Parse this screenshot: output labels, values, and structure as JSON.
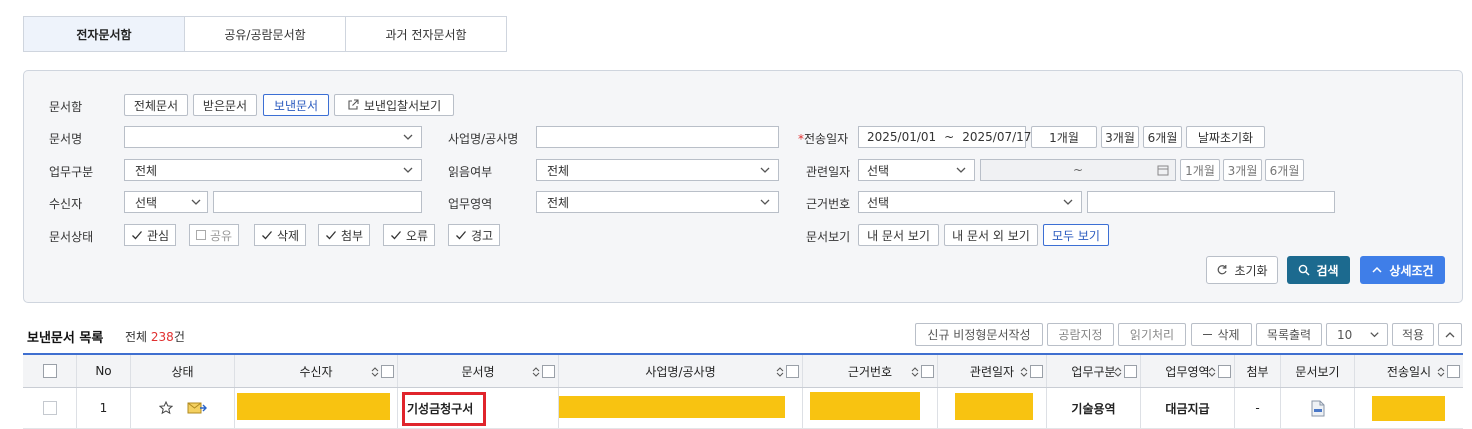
{
  "tabs": [
    "전자문서함",
    "공유/공람문서함",
    "과거 전자문서함"
  ],
  "labels": {
    "doc_box": "문서함",
    "doc_name": "문서명",
    "biz_name": "사업명/공사명",
    "send_date": "전송일자",
    "work_type": "업무구분",
    "read_status": "읽음여부",
    "related_date": "관련일자",
    "receiver": "수신자",
    "work_area": "업무영역",
    "basis_no": "근거번호",
    "doc_status": "문서상태",
    "doc_view": "문서보기"
  },
  "doc_box_buttons": [
    "전체문서",
    "받은문서",
    "보낸문서",
    "보낸입찰서보기"
  ],
  "doc_box_active": "보낸문서",
  "send_date": {
    "from": "2025/01/01",
    "sep": "~",
    "to": "2025/07/17"
  },
  "period_buttons": [
    "1개월",
    "3개월",
    "6개월"
  ],
  "date_reset": "날짜초기화",
  "selects": {
    "work_type": "전체",
    "read_status": "전체",
    "related_date": "선택",
    "receiver": "선택",
    "work_area": "전체",
    "basis_no": "선택"
  },
  "related_sep": "~",
  "status_checks": [
    {
      "label": "관심",
      "checked": true
    },
    {
      "label": "공유",
      "checked": false
    },
    {
      "label": "삭제",
      "checked": true
    },
    {
      "label": "첨부",
      "checked": true
    },
    {
      "label": "오류",
      "checked": true
    },
    {
      "label": "경고",
      "checked": true
    }
  ],
  "view_buttons": [
    "내 문서 보기",
    "내 문서 외 보기",
    "모두 보기"
  ],
  "view_active": "모두 보기",
  "actions": {
    "reset": "초기화",
    "search": "검색",
    "detail": "상세조건"
  },
  "list": {
    "title": "보낸문서 목록",
    "total_prefix": "전체 ",
    "total_count": "238",
    "total_suffix": "건"
  },
  "toolbar": [
    "신규 비정형문서작성",
    "공람지정",
    "읽기처리",
    "삭제",
    "목록출력"
  ],
  "page_size": "10",
  "apply": "적용",
  "columns": [
    "No",
    "상태",
    "수신자",
    "문서명",
    "사업명/공사명",
    "근거번호",
    "관련일자",
    "업무구분",
    "업무영역",
    "첨부",
    "문서보기",
    "전송일시"
  ],
  "rows": [
    {
      "no": "1",
      "doc_name": "기성금청구서",
      "work_type": "기술용역",
      "work_area": "대금지급",
      "attach": "-"
    }
  ],
  "colors": {
    "accent": "#3f7ee8",
    "search": "#1c6a8f",
    "highlight": "#e0242b",
    "redact": "#f8c311",
    "count": "#e03030"
  }
}
